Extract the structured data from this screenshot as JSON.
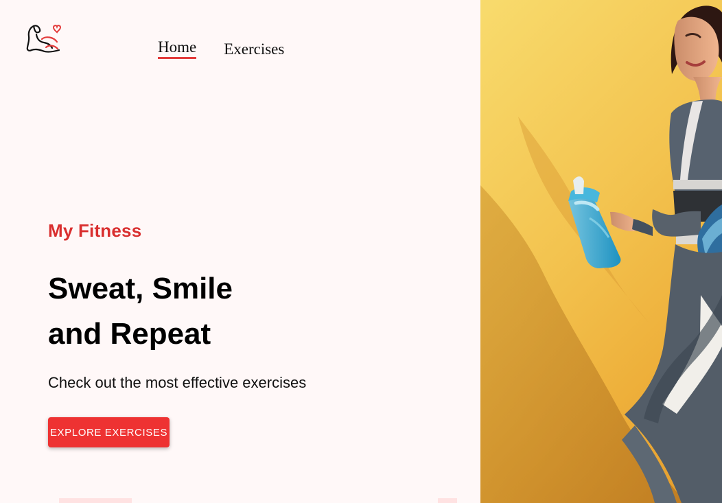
{
  "nav": {
    "items": [
      {
        "label": "Home",
        "active": true
      },
      {
        "label": "Exercises",
        "active": false
      }
    ]
  },
  "hero": {
    "kicker": "My Fitness",
    "headline_line_1": "Sweat, Smile",
    "headline_line_2": "and Repeat",
    "subtitle": "Check out the most effective exercises",
    "cta_label": "EXPLORE EXERCISES"
  },
  "colors": {
    "accent": "#d92f2f",
    "button": "#ee3232",
    "background": "#fff8f8",
    "hero_image_background": "#f3c34f"
  },
  "icons": {
    "logo": "flexed-arm-heart-icon"
  }
}
